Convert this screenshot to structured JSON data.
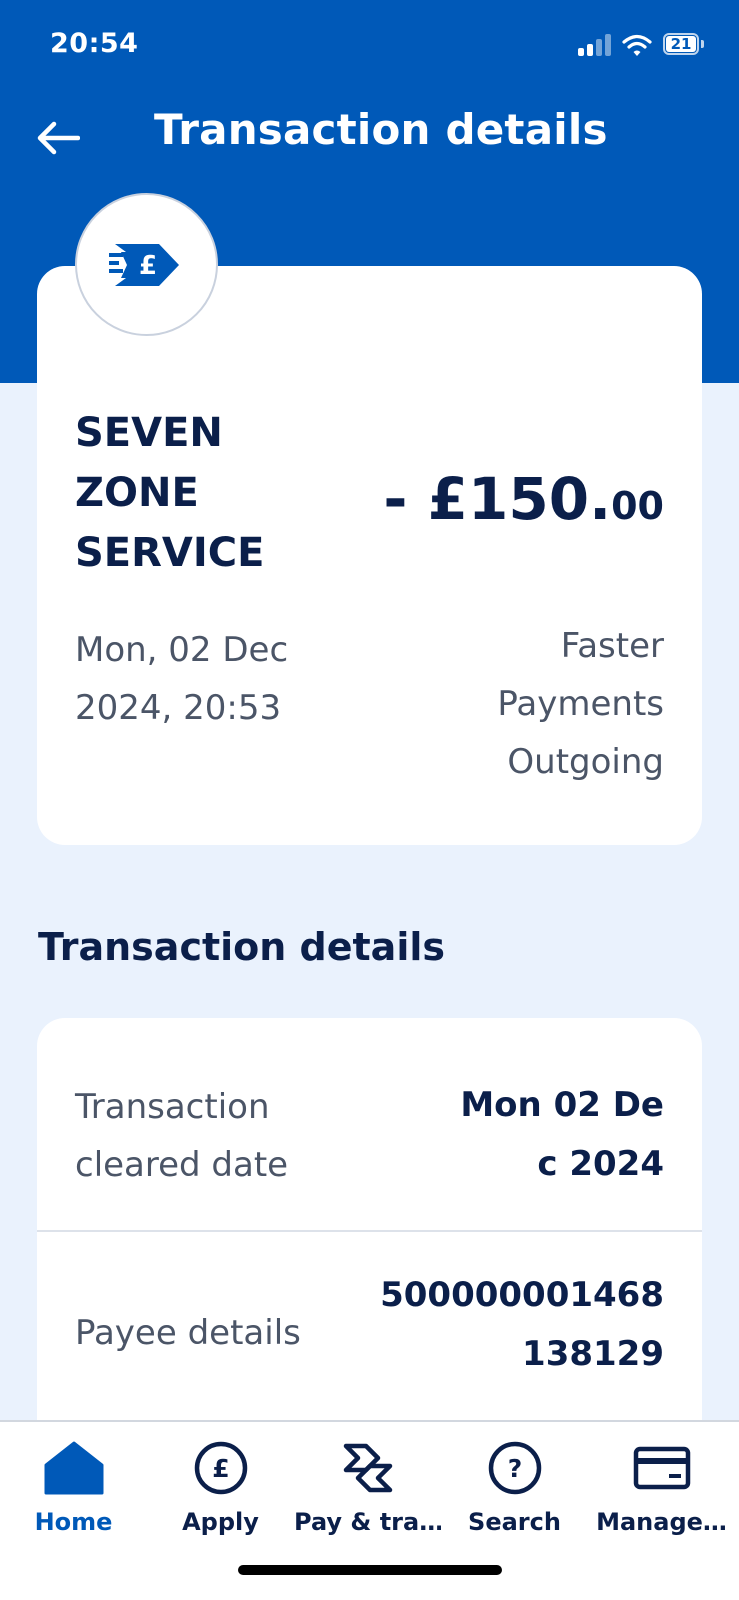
{
  "status_bar": {
    "time": "20:54",
    "battery": "21"
  },
  "header": {
    "title": "Transaction details",
    "back_icon": "arrow-left-icon",
    "background_color": "#0059b8"
  },
  "summary": {
    "icon": "faster-payment-pound-icon",
    "merchant_name": "SEVEN ZONE SERVICE",
    "amount_main": "- £150.",
    "amount_pence": "00",
    "date": "Mon, 02 Dec 2024, 20:53",
    "payment_type": "Faster Payments Outgoing"
  },
  "details": {
    "heading": "Transaction details",
    "rows": [
      {
        "label": "Transaction cleared date",
        "value": "Mon 02 Dec 2024"
      },
      {
        "label": "Payee details",
        "value": "500000001468 138129"
      }
    ]
  },
  "tab_bar": {
    "tabs": [
      {
        "label": "Home",
        "icon": "home-icon",
        "active": true
      },
      {
        "label": "Apply",
        "icon": "pound-circle-icon",
        "active": false
      },
      {
        "label": "Pay & tra…",
        "icon": "pay-transfer-icon",
        "active": false
      },
      {
        "label": "Search",
        "icon": "question-circle-icon",
        "active": false
      },
      {
        "label": "Manage…",
        "icon": "card-icon",
        "active": false
      }
    ],
    "active_color": "#0059b8"
  }
}
